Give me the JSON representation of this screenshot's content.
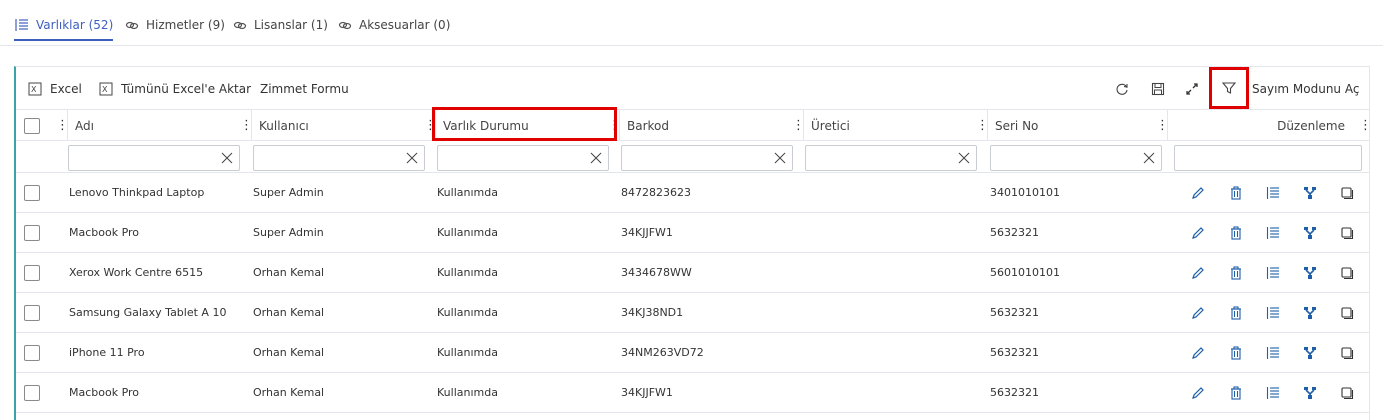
{
  "tabs": [
    {
      "label": "Varlıklar (52)",
      "icon": "list-icon",
      "active": true
    },
    {
      "label": "Hizmetler (9)",
      "icon": "link-icon",
      "active": false
    },
    {
      "label": "Lisanslar (1)",
      "icon": "link-icon",
      "active": false
    },
    {
      "label": "Aksesuarlar (0)",
      "icon": "link-icon",
      "active": false
    }
  ],
  "toolbar": {
    "excel_label": "Excel",
    "export_all_label": "Tümünü Excel'e Aktar",
    "assignment_form_label": "Zimmet Formu",
    "count_mode_label": "Sayım Modunu Aç",
    "icons": [
      "refresh-icon",
      "save-icon",
      "expand-icon",
      "filter-icon"
    ]
  },
  "table": {
    "columns": [
      "Adı",
      "Kullanıcı",
      "Varlık Durumu",
      "Barkod",
      "Üretici",
      "Seri No",
      "Düzenleme"
    ],
    "rows": [
      {
        "name": "Lenovo Thinkpad Laptop",
        "user": "Super Admin",
        "status": "Kullanımda",
        "barcode": "8472823623",
        "manufacturer": "",
        "serial": "3401010101"
      },
      {
        "name": "Macbook Pro",
        "user": "Super Admin",
        "status": "Kullanımda",
        "barcode": "34KJJFW1",
        "manufacturer": "",
        "serial": "5632321"
      },
      {
        "name": "Xerox Work Centre 6515",
        "user": "Orhan Kemal",
        "status": "Kullanımda",
        "barcode": "3434678WW",
        "manufacturer": "",
        "serial": "5601010101"
      },
      {
        "name": "Samsung Galaxy Tablet A 10",
        "user": "Orhan Kemal",
        "status": "Kullanımda",
        "barcode": "34KJ38ND1",
        "manufacturer": "",
        "serial": "5632321"
      },
      {
        "name": "iPhone 11 Pro",
        "user": "Orhan Kemal",
        "status": "Kullanımda",
        "barcode": "34NM263VD72",
        "manufacturer": "",
        "serial": "5632321"
      },
      {
        "name": "Macbook Pro",
        "user": "Orhan Kemal",
        "status": "Kullanımda",
        "barcode": "34KJJFW1",
        "manufacturer": "",
        "serial": "5632321"
      }
    ],
    "row_actions": [
      "edit-icon",
      "delete-icon",
      "details-list-icon",
      "assign-icon",
      "copy-icon"
    ]
  },
  "colors": {
    "accent": "#3f5fbf",
    "highlight": "#e00000",
    "action_blue": "#1f5fa8",
    "panel_edge": "#3aa3a6"
  }
}
